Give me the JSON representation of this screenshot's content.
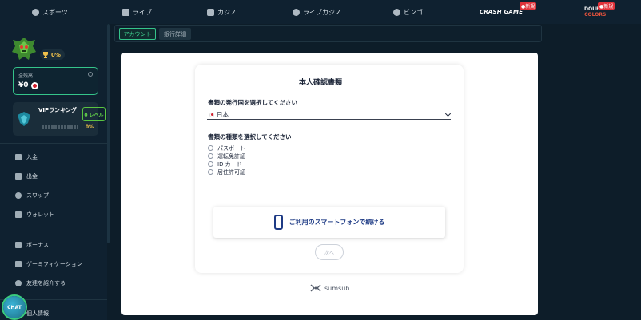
{
  "nav": {
    "items": [
      {
        "label": "スポーツ",
        "icon": "soccer-ball-icon"
      },
      {
        "label": "ライブ",
        "icon": "tv-icon"
      },
      {
        "label": "カジノ",
        "icon": "cards-icon"
      },
      {
        "label": "ライブカジノ",
        "icon": "chip-icon"
      },
      {
        "label": "ビンゴ",
        "icon": "bingo-ball-icon"
      }
    ],
    "crash_game": {
      "logo_a": "CRASH GAME",
      "logo_b": "🚀",
      "badge": "●新規"
    },
    "double_colors": {
      "line1": "DOUBLE",
      "line2": "COLORS",
      "badge": "●新規"
    }
  },
  "sidebar": {
    "trophy_pct": "0%",
    "balance": {
      "label": "全残高",
      "amount": "¥0"
    },
    "vip": {
      "title": "VIPランキング",
      "level": "0 レベル",
      "progress_pct": "0%",
      "progress": 0
    },
    "menu": [
      {
        "label": "入金",
        "icon": "deposit-arrow-icon"
      },
      {
        "label": "出金",
        "icon": "withdraw-arrow-icon"
      },
      {
        "label": "スワップ",
        "icon": "swap-icon"
      },
      {
        "label": "ウォレット",
        "icon": "wallet-icon"
      },
      {
        "label": "ボーナス",
        "icon": "gift-icon"
      },
      {
        "label": "ゲーミフィケーション",
        "icon": "crown-icon"
      },
      {
        "label": "友達を紹介する",
        "icon": "users-icon"
      },
      {
        "label": "個人情報",
        "icon": "user-icon"
      }
    ],
    "chat_label": "CHAT"
  },
  "tabs": {
    "active": "アカウント",
    "inactive": "銀行詳細"
  },
  "verification": {
    "title": "本人確認書類",
    "country_question": "書類の発行国を選択してください",
    "country_value": "日本",
    "doc_question": "書類の種類を選択してください",
    "doc_options": [
      "パスポート",
      "運転免許証",
      "ID カード",
      "居住許可証"
    ],
    "phone_button": "ご利用のスマートフォンで続ける",
    "next_button": "次へ",
    "powered_by": "sumsub"
  },
  "colors": {
    "accent": "#35c48a",
    "background": "#0d1d29",
    "button_text": "#1e3b85"
  }
}
